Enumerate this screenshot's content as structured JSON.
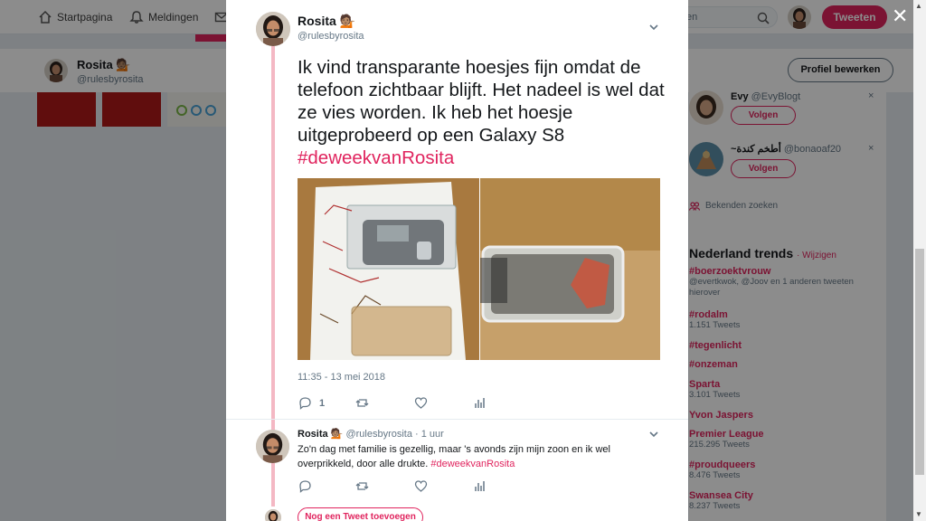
{
  "nav": {
    "home_label": "Startpagina",
    "notifications_label": "Meldingen",
    "search_placeholder": "en",
    "tweet_button": "Tweeten"
  },
  "profile": {
    "name": "Rosita 💁🏽",
    "handle": "@rulesbyrosita",
    "edit_button": "Profiel bewerken"
  },
  "sidebar": {
    "who_to_follow": [
      {
        "name": "Evy",
        "handle": "@EvyBlogt",
        "button": "Volgen",
        "dismiss": "×"
      },
      {
        "name": "~أطخم كندة",
        "handle": "@bonaoaf20",
        "button": "Volgen",
        "dismiss": "×"
      }
    ],
    "find_friends": "Bekenden zoeken",
    "trends_title": "Nederland trends",
    "trends_change": "· Wijzigen",
    "trends": [
      {
        "name": "#boerzoektvrouw",
        "meta": "@evertkwok, @Joov en 1 anderen tweeten hierover"
      },
      {
        "name": "#rodalm",
        "meta": "1.151 Tweets"
      },
      {
        "name": "#tegenlicht",
        "meta": ""
      },
      {
        "name": "#onzeman",
        "meta": ""
      },
      {
        "name": "Sparta",
        "meta": "3.101 Tweets"
      },
      {
        "name": "Yvon Jaspers",
        "meta": ""
      },
      {
        "name": "Premier League",
        "meta": "215.295 Tweets"
      },
      {
        "name": "#proudqueers",
        "meta": "8.476 Tweets"
      },
      {
        "name": "Swansea City",
        "meta": "8.237 Tweets"
      }
    ]
  },
  "tweet": {
    "name": "Rosita 💁🏽",
    "handle": "@rulesbyrosita",
    "text": "Ik vind transparante hoesjes fijn omdat de telefoon zichtbaar blijft. Het nadeel is wel dat ze vies worden. Ik heb het hoesje uitgeprobeerd op een Galaxy S8",
    "hashtag": "#deweekvanRosita",
    "timestamp": "11:35 - 13 mei 2018",
    "reply_count": "1",
    "retweet_count": "",
    "like_count": ""
  },
  "reply": {
    "name": "Rosita 💁🏽",
    "handle": "@rulesbyrosita",
    "time": "· 1 uur",
    "text": "Zo'n dag met familie is gezellig, maar 's avonds zijn mijn zoon en ik wel overprikkeld, door alle drukte.",
    "hashtag": "#deweekvanRosita"
  },
  "add_tweet_button": "Nog een Tweet toevoegen",
  "close_label": "✕",
  "colors": {
    "accent": "#e0245e",
    "thread_line": "#f4b8c4",
    "muted": "#657786"
  }
}
